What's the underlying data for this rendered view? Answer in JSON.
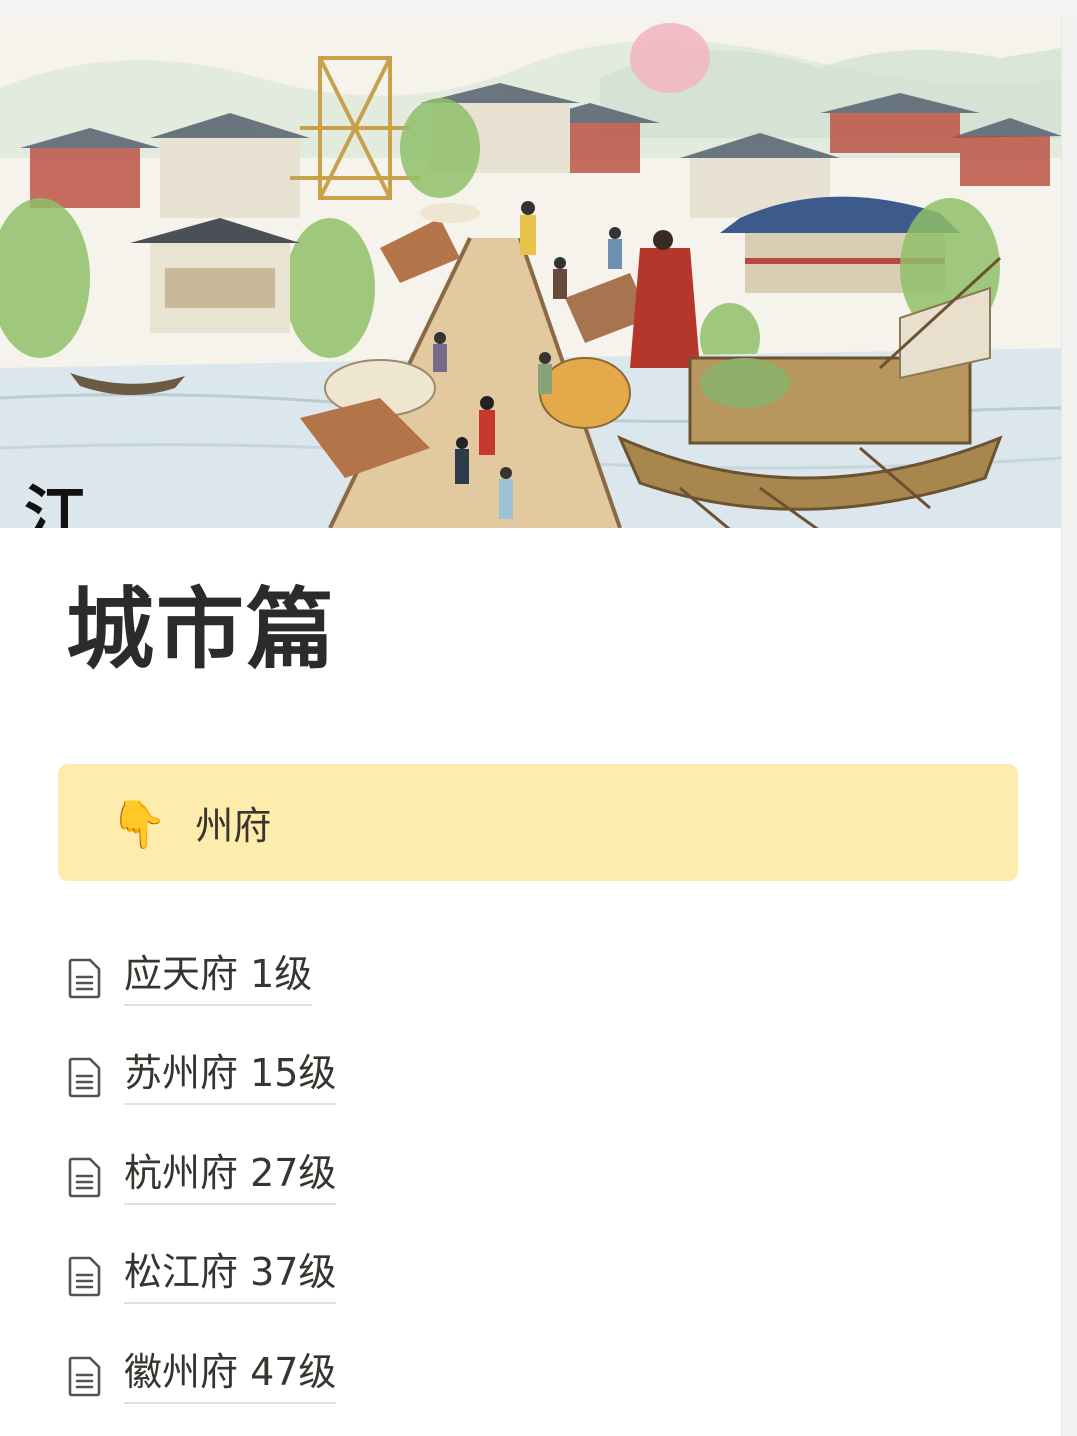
{
  "page": {
    "title": "城市篇"
  },
  "cover": {
    "calligraphy": "江"
  },
  "callout": {
    "icon": "point-down-emoji",
    "emoji": "👇",
    "text": "州府",
    "background": "#fdecab"
  },
  "subpages": [
    {
      "label": "应天府 1级",
      "icon": "page-icon"
    },
    {
      "label": "苏州府 15级",
      "icon": "page-icon"
    },
    {
      "label": "杭州府 27级",
      "icon": "page-icon"
    },
    {
      "label": "松江府 37级",
      "icon": "page-icon"
    },
    {
      "label": "徽州府 47级",
      "icon": "page-icon"
    }
  ]
}
